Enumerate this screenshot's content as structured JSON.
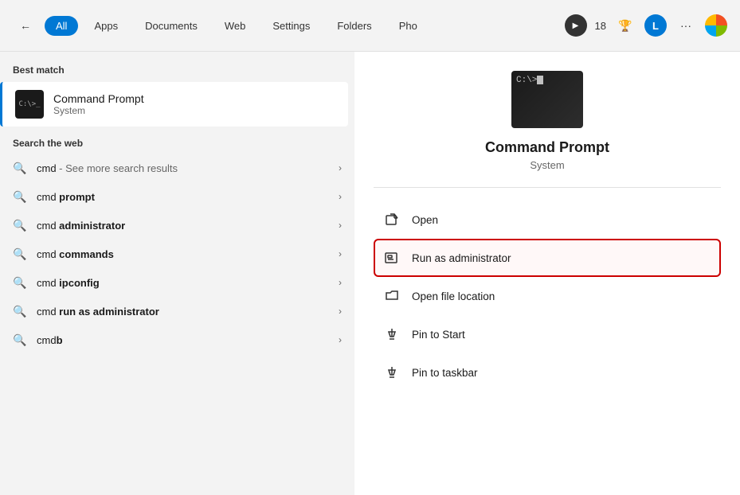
{
  "topbar": {
    "back_label": "←",
    "tabs": [
      {
        "id": "all",
        "label": "All",
        "active": true
      },
      {
        "id": "apps",
        "label": "Apps",
        "active": false
      },
      {
        "id": "documents",
        "label": "Documents",
        "active": false
      },
      {
        "id": "web",
        "label": "Web",
        "active": false
      },
      {
        "id": "settings",
        "label": "Settings",
        "active": false
      },
      {
        "id": "folders",
        "label": "Folders",
        "active": false
      },
      {
        "id": "photos",
        "label": "Pho",
        "active": false
      }
    ],
    "badge_count": "18",
    "user_initial": "L",
    "more_label": "···"
  },
  "left_panel": {
    "best_match_label": "Best match",
    "best_match": {
      "name": "Command Prompt",
      "sub": "System"
    },
    "web_section_label": "Search the web",
    "search_items": [
      {
        "prefix": "cmd",
        "middle": " - See more search results",
        "suffix": "",
        "bold_part": ""
      },
      {
        "prefix": "cmd ",
        "bold_part": "prompt",
        "middle": "",
        "suffix": ""
      },
      {
        "prefix": "cmd ",
        "bold_part": "administrator",
        "middle": "",
        "suffix": ""
      },
      {
        "prefix": "cmd ",
        "bold_part": "commands",
        "middle": "",
        "suffix": ""
      },
      {
        "prefix": "cmd ",
        "bold_part": "ipconfig",
        "middle": "",
        "suffix": ""
      },
      {
        "prefix": "cmd ",
        "bold_part": "run as administrator",
        "middle": "",
        "suffix": ""
      },
      {
        "prefix": "cmd",
        "bold_part": "b",
        "middle": "",
        "suffix": ""
      }
    ]
  },
  "right_panel": {
    "app_name": "Command Prompt",
    "app_sub": "System",
    "actions": [
      {
        "id": "open",
        "label": "Open",
        "icon": "open-icon"
      },
      {
        "id": "run-admin",
        "label": "Run as administrator",
        "icon": "admin-icon",
        "highlighted": true
      },
      {
        "id": "open-location",
        "label": "Open file location",
        "icon": "folder-icon"
      },
      {
        "id": "pin-start",
        "label": "Pin to Start",
        "icon": "pin-icon"
      },
      {
        "id": "pin-taskbar",
        "label": "Pin to taskbar",
        "icon": "pin-icon-2"
      }
    ]
  }
}
